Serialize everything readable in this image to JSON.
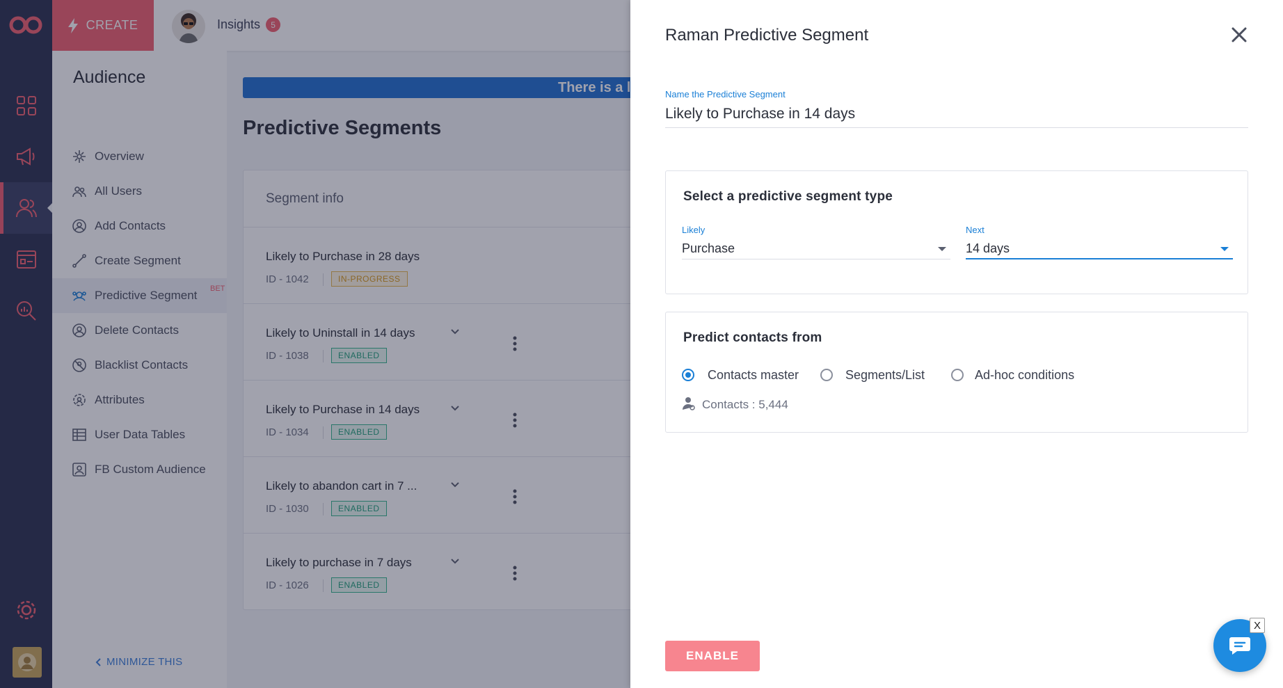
{
  "topbar": {
    "create_label": "CREATE",
    "insights_label": "Insights",
    "insights_badge": "5"
  },
  "subnav": {
    "title": "Audience",
    "items": [
      {
        "label": "Overview",
        "icon": "overview-icon"
      },
      {
        "label": "All Users",
        "icon": "users-icon"
      },
      {
        "label": "Add Contacts",
        "icon": "add-contact-icon"
      },
      {
        "label": "Create Segment",
        "icon": "segment-icon"
      },
      {
        "label": "Predictive Segment",
        "icon": "predictive-icon",
        "badge": "BET"
      },
      {
        "label": "Delete Contacts",
        "icon": "delete-contact-icon"
      },
      {
        "label": "Blacklist Contacts",
        "icon": "blacklist-icon"
      },
      {
        "label": "Attributes",
        "icon": "attributes-icon"
      },
      {
        "label": "User Data Tables",
        "icon": "table-icon"
      },
      {
        "label": "FB Custom Audience",
        "icon": "fb-audience-icon"
      }
    ],
    "minimize_label": "MINIMIZE THIS"
  },
  "main": {
    "banner_text": "There is a l",
    "page_title": "Predictive Segments",
    "table_header": "Segment info",
    "rows": [
      {
        "name": "Likely to Purchase in 28 days",
        "id": "ID - 1042",
        "status": "IN-PROGRESS"
      },
      {
        "name": "Likely to Uninstall in 14 days",
        "id": "ID - 1038",
        "status": "ENABLED"
      },
      {
        "name": "Likely to Purchase in 14 days",
        "id": "ID - 1034",
        "status": "ENABLED"
      },
      {
        "name": "Likely to abandon cart in 7 ...",
        "id": "ID - 1030",
        "status": "ENABLED"
      },
      {
        "name": "Likely to purchase in 7 days",
        "id": "ID - 1026",
        "status": "ENABLED"
      }
    ]
  },
  "drawer": {
    "title": "Raman Predictive Segment",
    "name_label": "Name the Predictive Segment",
    "name_value": "Likely to Purchase in 14 days",
    "type_section": {
      "heading": "Select a predictive segment type",
      "likely_label": "Likely",
      "likely_value": "Purchase",
      "next_label": "Next",
      "next_value": "14 days"
    },
    "predict_section": {
      "heading": "Predict contacts from",
      "options": [
        "Contacts master",
        "Segments/List",
        "Ad-hoc conditions"
      ],
      "selected": "Contacts master",
      "contacts_count": "Contacts : 5,444"
    },
    "enable_label": "ENABLE"
  },
  "chat": {
    "close_label": "X"
  },
  "colors": {
    "rail": "#2a2f4f",
    "brand": "#f2606f",
    "accent": "#1a7fd6",
    "enabled": "#22a07a",
    "in_progress": "#d99a1b"
  }
}
